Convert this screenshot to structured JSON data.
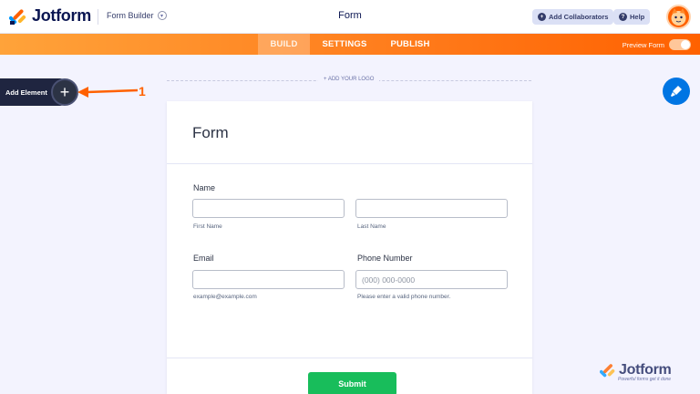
{
  "header": {
    "brand": "Jotform",
    "builder_selector": "Form Builder",
    "form_title": "Form",
    "collaborators_label": "Add Collaborators",
    "help_label": "Help"
  },
  "nav": {
    "tabs": [
      {
        "label": "BUILD",
        "active": true
      },
      {
        "label": "SETTINGS",
        "active": false
      },
      {
        "label": "PUBLISH",
        "active": false
      }
    ],
    "preview_label": "Preview Form"
  },
  "builder": {
    "add_element_label": "Add Element",
    "annotation": "1",
    "add_logo_label": "+ ADD YOUR LOGO"
  },
  "form": {
    "title": "Form",
    "name": {
      "label": "Name",
      "first_sublabel": "First Name",
      "last_sublabel": "Last Name"
    },
    "email": {
      "label": "Email",
      "sublabel": "example@example.com"
    },
    "phone": {
      "label": "Phone Number",
      "placeholder": "(000) 000-0000",
      "sublabel": "Please enter a valid phone number."
    },
    "submit_label": "Submit"
  },
  "watermark": {
    "brand": "Jotform",
    "tagline": "Powerful forms get it done"
  },
  "colors": {
    "accent_orange": "#ff6100",
    "navy": "#0a1551",
    "submit_green": "#18bd5b",
    "brush_blue": "#0075e3"
  },
  "icons": [
    "jotform-logo-icon",
    "chevron-down-icon",
    "add-user-icon",
    "help-icon",
    "avatar",
    "plus-icon",
    "paint-brush-icon"
  ]
}
